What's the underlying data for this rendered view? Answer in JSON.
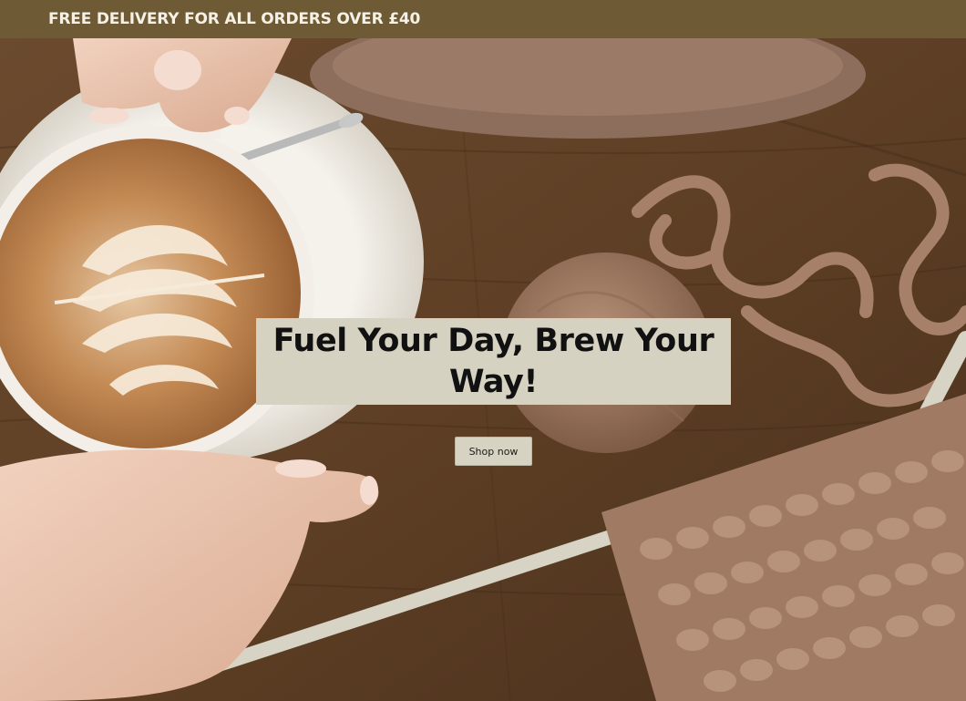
{
  "announcement": {
    "text": "FREE DELIVERY FOR ALL ORDERS OVER £40"
  },
  "hero": {
    "headline": "Fuel Your Day, Brew Your Way!",
    "cta_label": "Shop now",
    "image_content": [
      "hands-holding-latte-cup",
      "saucer-with-spoon",
      "felt-hat",
      "yarn-ball",
      "knitting-needles-with-knit-swatch",
      "wooden-table"
    ]
  },
  "colors": {
    "announcement_bg": "#6e5a35",
    "announcement_text": "#f6f1e6",
    "headline_box_bg": "#d6d2c2",
    "headline_text": "#111111",
    "button_bg": "#d7d3c3"
  }
}
